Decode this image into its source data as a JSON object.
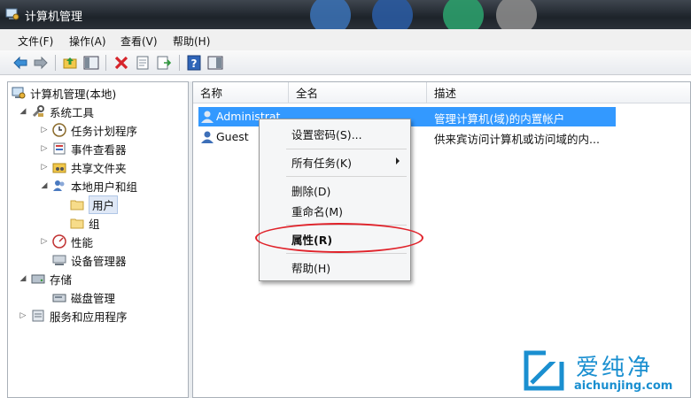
{
  "window": {
    "title": "计算机管理"
  },
  "menubar": [
    {
      "label": "文件(F)"
    },
    {
      "label": "操作(A)"
    },
    {
      "label": "查看(V)"
    },
    {
      "label": "帮助(H)"
    }
  ],
  "toolbar": [
    {
      "icon": "back-arrow-icon"
    },
    {
      "icon": "forward-arrow-icon"
    },
    {
      "icon": "up-folder-icon"
    },
    {
      "icon": "show-hide-tree-icon"
    },
    {
      "icon": "delete-icon"
    },
    {
      "icon": "properties-icon"
    },
    {
      "icon": "export-list-icon"
    },
    {
      "icon": "help-icon"
    },
    {
      "icon": "view-icon"
    }
  ],
  "tree": {
    "root": "计算机管理(本地)",
    "system_tools": "系统工具",
    "task_scheduler": "任务计划程序",
    "event_viewer": "事件查看器",
    "shared_folders": "共享文件夹",
    "local_users_groups": "本地用户和组",
    "users": "用户",
    "groups": "组",
    "performance": "性能",
    "device_manager": "设备管理器",
    "storage": "存储",
    "disk_management": "磁盘管理",
    "services_apps": "服务和应用程序"
  },
  "list": {
    "columns": [
      "名称",
      "全名",
      "描述"
    ],
    "rows": [
      {
        "name": "Administrat...",
        "full_name": "",
        "description": "管理计算机(域)的内置帐户"
      },
      {
        "name": "Guest",
        "full_name": "",
        "description": "供来宾访问计算机或访问域的内..."
      }
    ]
  },
  "context_menu": {
    "set_password": "设置密码(S)...",
    "all_tasks": "所有任务(K)",
    "delete": "删除(D)",
    "rename": "重命名(M)",
    "properties": "属性(R)",
    "help": "帮助(H)"
  },
  "watermark": {
    "text": "爱纯净",
    "url": "aichunjing.com"
  },
  "colors": {
    "selection": "#3399ff",
    "highlight_ring": "#e0222a",
    "watermark": "#1a8fd0"
  }
}
